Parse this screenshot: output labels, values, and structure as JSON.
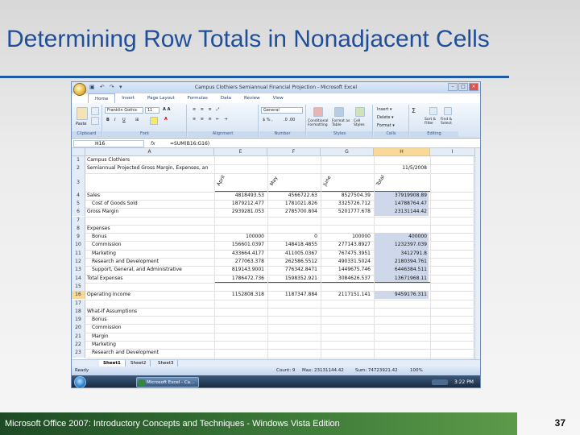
{
  "slide": {
    "title": "Determining Row Totals in Nonadjacent Cells",
    "footer": "Microsoft Office 2007: Introductory Concepts and Techniques - Windows Vista Edition",
    "page_number": "37"
  },
  "excel": {
    "window_title": "Campus Clothiers Semiannual Financial Projection - Microsoft Excel",
    "tabs": [
      "Home",
      "Insert",
      "Page Layout",
      "Formulas",
      "Data",
      "Review",
      "View"
    ],
    "active_tab": "Home",
    "ribbon": {
      "font_name": "Franklin Gothic",
      "font_size": "11",
      "number_format": "General",
      "groups": [
        "Clipboard",
        "Font",
        "Alignment",
        "Number",
        "Styles",
        "Cells",
        "Editing"
      ],
      "paste": "Paste",
      "conditional_formatting": "Conditional Formatting",
      "format_as_table": "Format as Table",
      "cell_styles": "Cell Styles",
      "insert": "Insert",
      "delete": "Delete",
      "format": "Format",
      "sort_filter": "Sort & Filter",
      "find_select": "Find & Select"
    },
    "name_box": "H16",
    "fx": "fx",
    "formula": "=SUM(B16:G16)",
    "columns": [
      "A",
      "E",
      "F",
      "G",
      "H",
      "I"
    ],
    "headers_row3": [
      "April",
      "May",
      "June",
      "Total"
    ],
    "date": "11/5/2008",
    "rows": [
      {
        "n": "1",
        "a": "Campus Clothiers",
        "e": "",
        "f": "",
        "g": "",
        "h": ""
      },
      {
        "n": "2",
        "a": "Semiannual Projected Gross Margin, Expenses, an",
        "e": "",
        "f": "",
        "g": "",
        "h": ""
      },
      {
        "n": "3",
        "a": "",
        "e": "",
        "f": "",
        "g": "",
        "h": ""
      },
      {
        "n": "4",
        "a": "Sales",
        "e": "4818493.53",
        "f": "4566722.63",
        "g": "8527504.39",
        "h": "37919908.89"
      },
      {
        "n": "5",
        "a": "Cost of Goods Sold",
        "e": "1879212.477",
        "f": "1781021.826",
        "g": "3325726.712",
        "h": "14788764.47"
      },
      {
        "n": "6",
        "a": "Gross Margin",
        "e": "2939281.053",
        "f": "2785700.804",
        "g": "5201777.678",
        "h": "23131144.42"
      },
      {
        "n": "7",
        "a": "",
        "e": "",
        "f": "",
        "g": "",
        "h": ""
      },
      {
        "n": "8",
        "a": "Expenses",
        "e": "",
        "f": "",
        "g": "",
        "h": ""
      },
      {
        "n": "9",
        "a": "Bonus",
        "e": "100000",
        "f": "0",
        "g": "100000",
        "h": "400000"
      },
      {
        "n": "10",
        "a": "Commission",
        "e": "156601.0397",
        "f": "148418.4855",
        "g": "277143.8927",
        "h": "1232397.039"
      },
      {
        "n": "11",
        "a": "Marketing",
        "e": "433664.4177",
        "f": "411005.0367",
        "g": "767475.3951",
        "h": "3412791.8"
      },
      {
        "n": "12",
        "a": "Research and Development",
        "e": "277063.378",
        "f": "262586.5512",
        "g": "490331.5024",
        "h": "2180394.761"
      },
      {
        "n": "13",
        "a": "Support, General, and Administrative",
        "e": "819143.9001",
        "f": "776342.8471",
        "g": "1449675.746",
        "h": "6446384.511"
      },
      {
        "n": "14",
        "a": "Total Expenses",
        "e": "1786472.736",
        "f": "1598352.921",
        "g": "3084626.537",
        "h": "13671968.11"
      },
      {
        "n": "15",
        "a": "",
        "e": "",
        "f": "",
        "g": "",
        "h": ""
      },
      {
        "n": "16",
        "a": "Operating Income",
        "e": "1152808.318",
        "f": "1187347.884",
        "g": "2117151.141",
        "h": "9459176.311"
      },
      {
        "n": "17",
        "a": "",
        "e": "",
        "f": "",
        "g": "",
        "h": ""
      },
      {
        "n": "18",
        "a": "What-If Assumptions",
        "e": "",
        "f": "",
        "g": "",
        "h": ""
      },
      {
        "n": "19",
        "a": "Bonus",
        "e": "",
        "f": "",
        "g": "",
        "h": ""
      },
      {
        "n": "20",
        "a": "Commission",
        "e": "",
        "f": "",
        "g": "",
        "h": ""
      },
      {
        "n": "21",
        "a": "Margin",
        "e": "",
        "f": "",
        "g": "",
        "h": ""
      },
      {
        "n": "22",
        "a": "Marketing",
        "e": "",
        "f": "",
        "g": "",
        "h": ""
      },
      {
        "n": "23",
        "a": "Research and Development",
        "e": "",
        "f": "",
        "g": "",
        "h": ""
      }
    ],
    "sheet_tabs": [
      "Sheet1",
      "Sheet2",
      "Sheet3"
    ],
    "status": {
      "ready": "Ready",
      "count": "Count: 9",
      "max": "Max: 23131144.42",
      "sum": "Sum: 74723921.42",
      "zoom": "100%"
    },
    "taskbar": {
      "item": "Microsoft Excel - Ca...",
      "clock": "3:22 PM"
    }
  }
}
